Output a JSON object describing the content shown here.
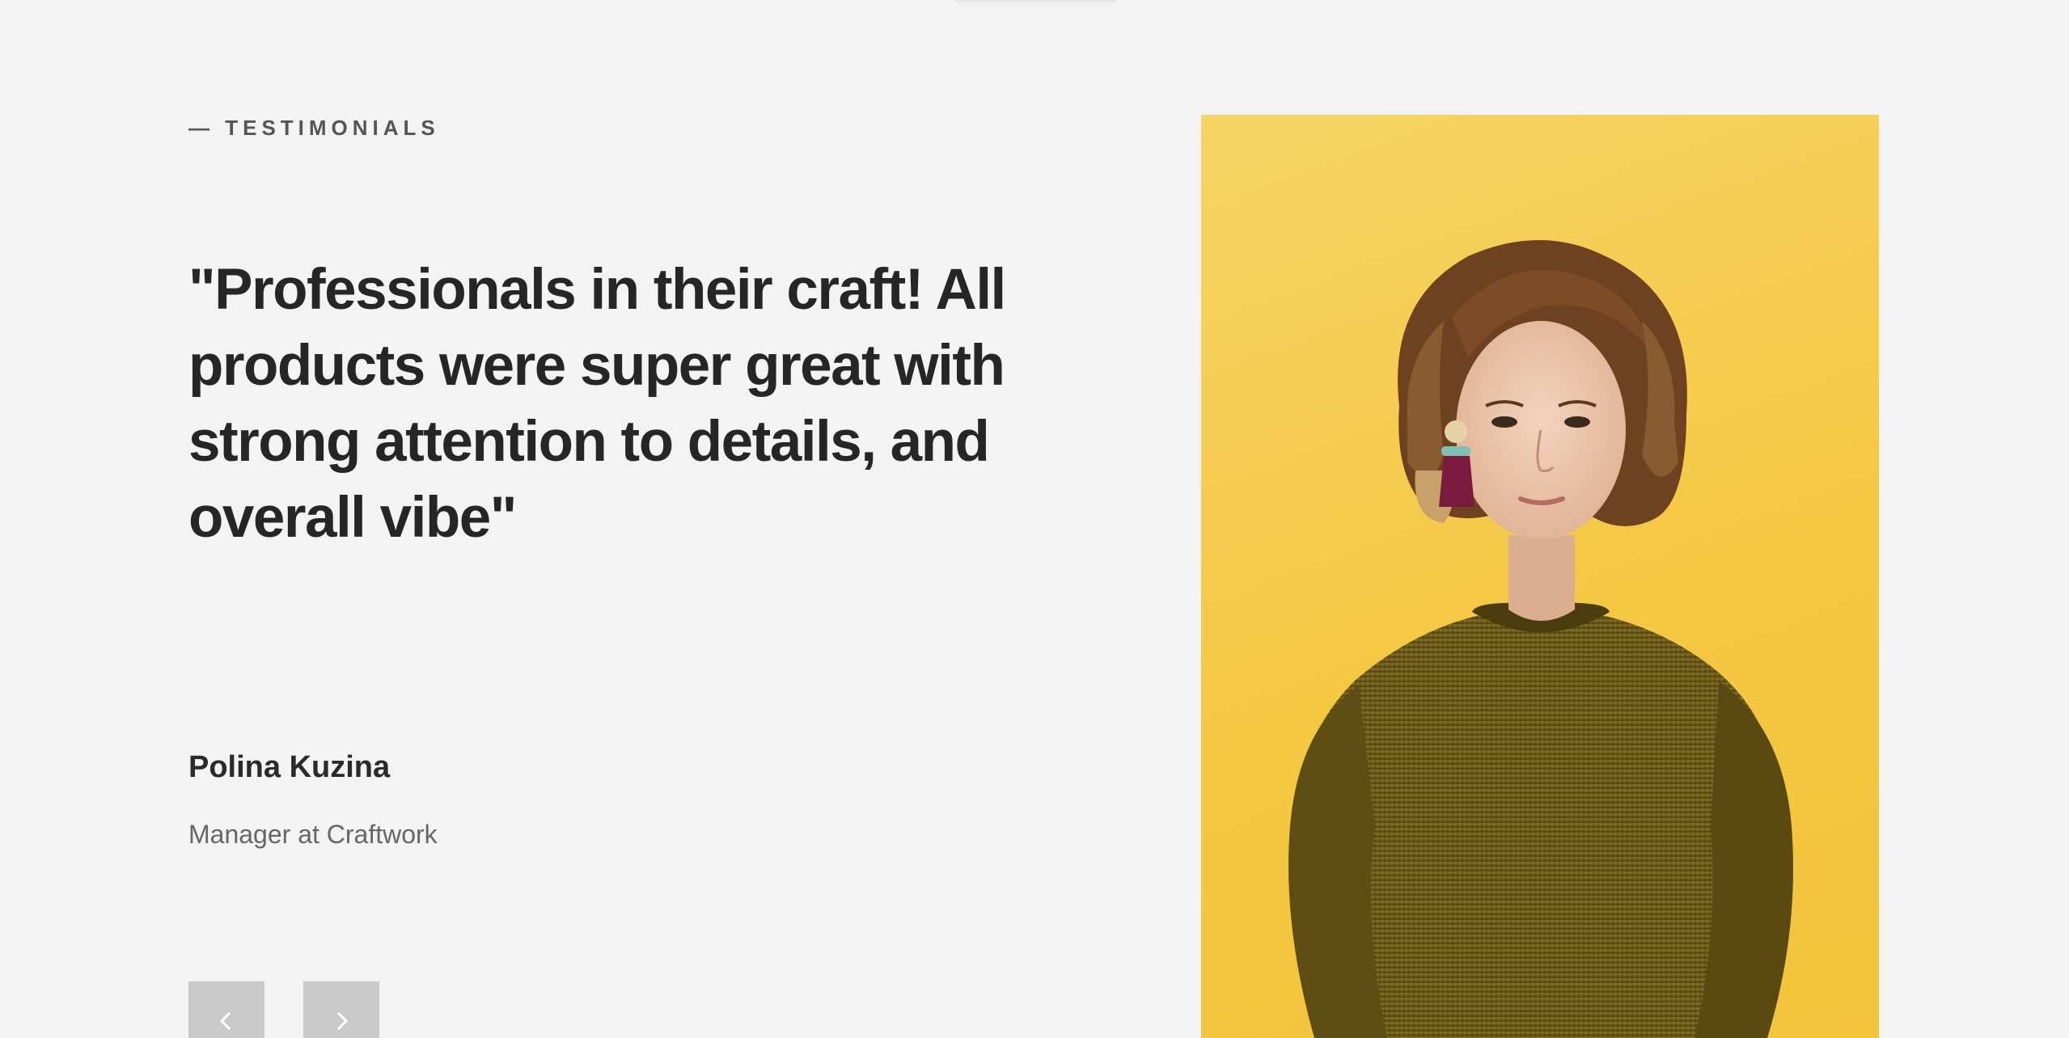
{
  "section": {
    "eyebrow": "— TESTIMONIALS"
  },
  "testimonial": {
    "quote": "\"Professionals in their craft! All products were super great with strong attention to details, and overall vibe\"",
    "author_name": "Polina Kuzina",
    "author_role": "Manager at Craftwork"
  },
  "navigation": {
    "prev_icon": "chevron-left-icon",
    "next_icon": "chevron-right-icon"
  },
  "photo": {
    "background_color": "#f5c842",
    "sweater_color": "#6b5a18",
    "hair_color": "#7a4a24"
  }
}
